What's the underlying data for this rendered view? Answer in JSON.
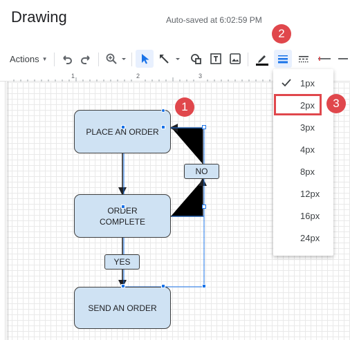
{
  "app": {
    "title": "Drawing",
    "autosave": "Auto-saved at 6:02:59 PM"
  },
  "toolbar": {
    "actions_label": "Actions",
    "icons": [
      "undo-icon",
      "redo-icon",
      "zoom-icon",
      "select-icon",
      "line-icon",
      "shape-icon",
      "text-box-icon",
      "image-icon",
      "line-color-icon",
      "line-weight-icon",
      "line-dash-icon",
      "line-start-icon",
      "line-end-icon"
    ]
  },
  "ruler": {
    "marks": [
      "1",
      "2",
      "3"
    ]
  },
  "canvas": {
    "shapes": [
      {
        "text": "PLACE AN ORDER"
      },
      {
        "line1": "ORDER",
        "line2": "COMPLETE"
      },
      {
        "text": "SEND AN ORDER"
      }
    ],
    "labels": [
      {
        "text": "NO"
      },
      {
        "text": "YES"
      }
    ]
  },
  "line_weight_menu": {
    "selected": "1px",
    "items": [
      "1px",
      "2px",
      "3px",
      "4px",
      "8px",
      "12px",
      "16px",
      "24px"
    ]
  },
  "callouts": [
    "1",
    "2",
    "3"
  ],
  "colors": {
    "accent": "#1a73e8",
    "shape_fill": "#cfe2f3",
    "callout": "#e0474c"
  }
}
